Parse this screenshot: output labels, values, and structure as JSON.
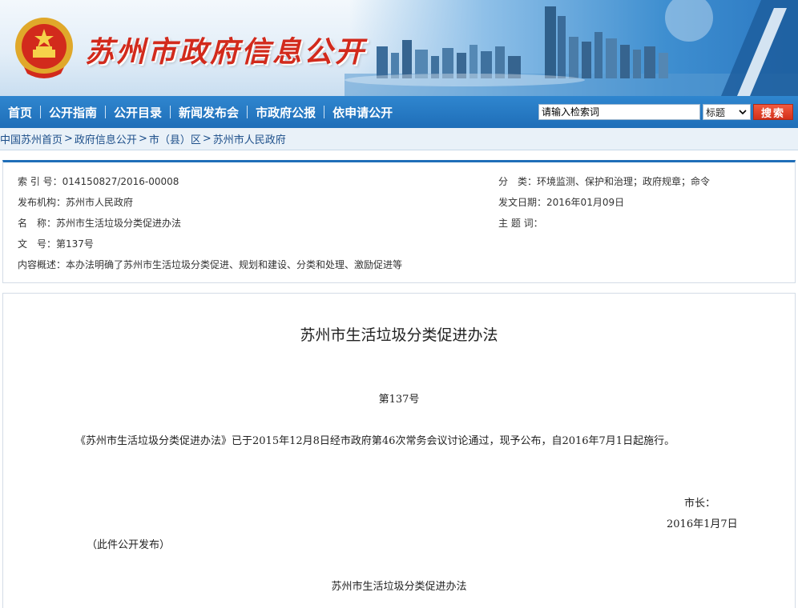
{
  "banner": {
    "site_title": "苏州市政府信息公开"
  },
  "nav": {
    "items": [
      {
        "label": "首页"
      },
      {
        "label": "公开指南"
      },
      {
        "label": "公开目录"
      },
      {
        "label": "新闻发布会"
      },
      {
        "label": "市政府公报"
      },
      {
        "label": "依申请公开"
      }
    ],
    "search": {
      "value": "请输入检索词",
      "select_value": "标题",
      "button_label": "搜索"
    }
  },
  "breadcrumb": {
    "items": [
      "中国苏州首页",
      "政府信息公开",
      "市（县）区",
      "苏州市人民政府"
    ],
    "separator": ">"
  },
  "meta": {
    "index_label": "索 引 号：",
    "index_value": "014150827/2016-00008",
    "category_label": "分　类：",
    "category_value": "环境监测、保护和治理；政府规章；命令",
    "issuer_label": "发布机构：",
    "issuer_value": "苏州市人民政府",
    "date_label": "发文日期：",
    "date_value": "2016年01月09日",
    "name_label": "名　称：",
    "name_value": "苏州市生活垃圾分类促进办法",
    "keywords_label": "主 题 词：",
    "keywords_value": "",
    "docno_label": "文　号：",
    "docno_value": "第137号",
    "summary_label": "内容概述：",
    "summary_value": "本办法明确了苏州市生活垃圾分类促进、规划和建设、分类和处理、激励促进等"
  },
  "document": {
    "title": "苏州市生活垃圾分类促进办法",
    "number": "第137号",
    "paragraph": "《苏州市生活垃圾分类促进办法》已于2015年12月8日经市政府第46次常务会议讨论通过，现予公布，自2016年7月1日起施行。",
    "mayor_label": "市长：",
    "sign_date": "2016年1月7日",
    "note": "（此件公开发布）",
    "subtitle": "苏州市生活垃圾分类促进办法"
  },
  "colors": {
    "nav_blue": "#1f6eb8",
    "title_red": "#d22a1c",
    "search_button_red": "#d3301a",
    "breadcrumb_text": "#1d4f8a"
  }
}
